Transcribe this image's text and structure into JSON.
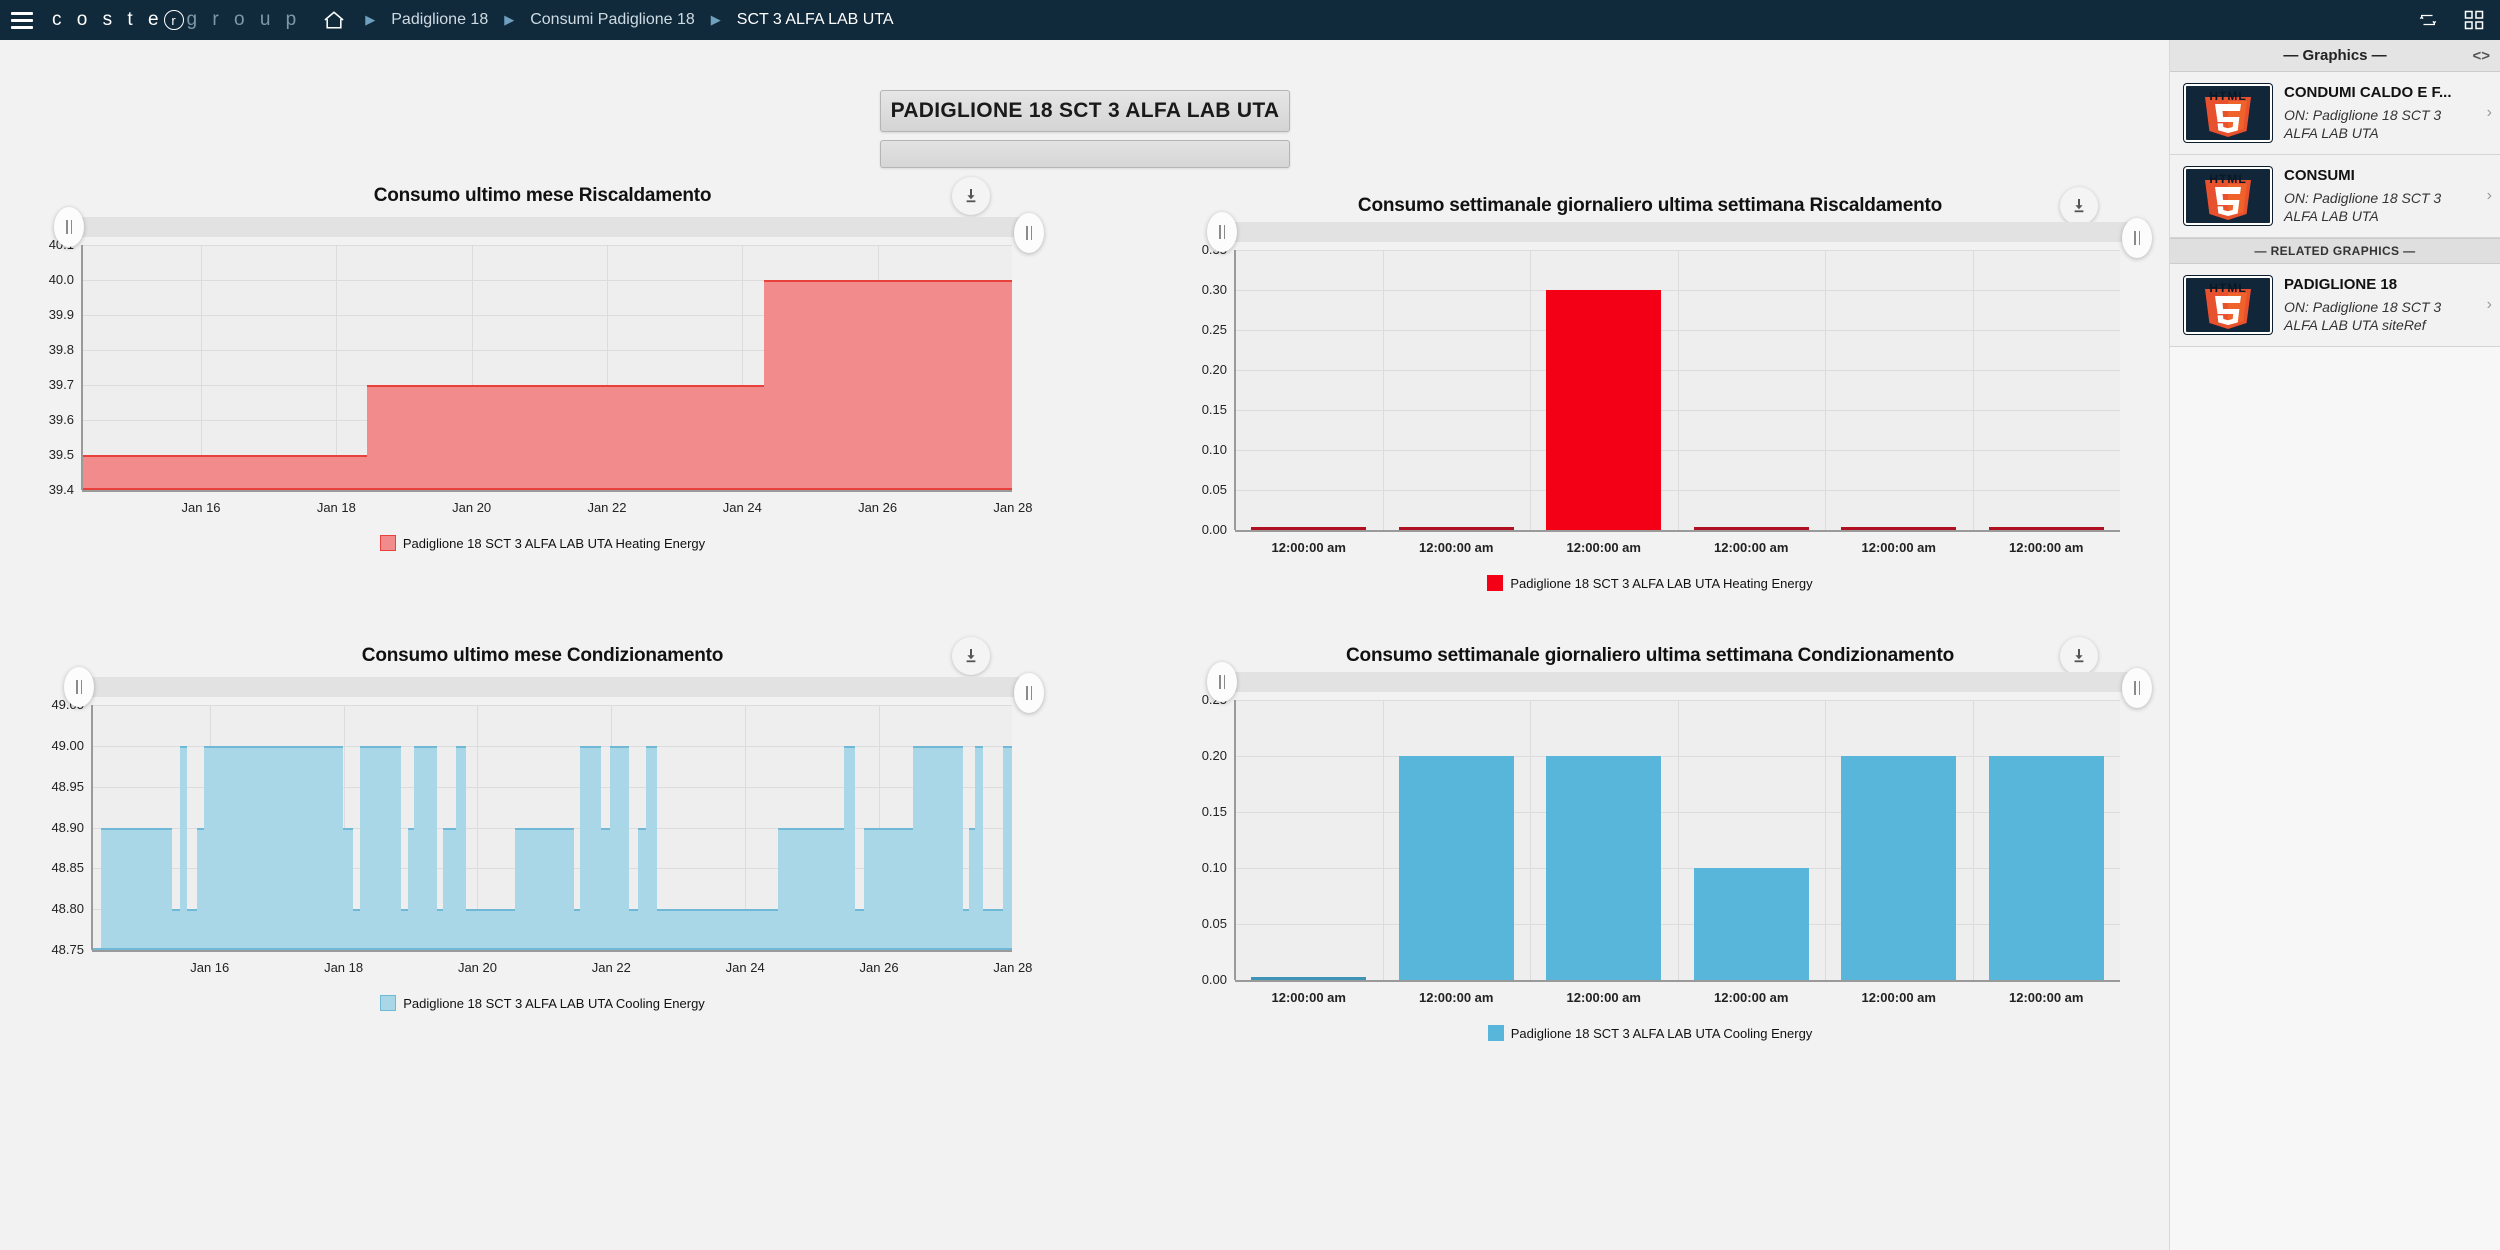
{
  "nav": {
    "menu_icon": "hamburger-icon",
    "brand_part1": "c o s t e",
    "brand_r": "r",
    "brand_part2": "g r o u p",
    "home_icon": "home-icon",
    "breadcrumbs": [
      {
        "label": "Padiglione 18"
      },
      {
        "label": "Consumi Padiglione 18"
      },
      {
        "label": "SCT 3 ALFA LAB UTA"
      }
    ],
    "right_icons": [
      {
        "name": "refresh-cycle-icon"
      },
      {
        "name": "apps-grid-icon"
      }
    ]
  },
  "banner": {
    "title": "PADIGLIONE 18 SCT 3 ALFA LAB UTA",
    "subtitle": ""
  },
  "colors": {
    "nav_bg": "#102a3c",
    "heating_fill": "#f28b8b",
    "heating_stroke": "#e8413c",
    "heating_bar": "#f40016",
    "cooling_fill": "#a9d7e8",
    "cooling_bar": "#57b6da",
    "plot_bg": "#eeeeee"
  },
  "charts": [
    {
      "id": "chart-heating-month",
      "title": "Consumo ultimo mese Riscaldamento",
      "download_icon": "download-icon",
      "legend": "Padiglione 18 SCT 3 ALFA LAB UTA Heating Energy",
      "chart_data": {
        "type": "area",
        "title": "Consumo ultimo mese Riscaldamento",
        "xlabel": "",
        "ylabel": "",
        "ylim": [
          39.4,
          40.1
        ],
        "yticks": [
          "39.4",
          "39.5",
          "39.6",
          "39.7",
          "39.8",
          "39.9",
          "40.0",
          "40.1"
        ],
        "xticks": [
          "Jan 16",
          "Jan 18",
          "Jan 20",
          "Jan 22",
          "Jan 24",
          "Jan 26",
          "Jan 28"
        ],
        "grid": true,
        "legend_position": "bottom",
        "series": [
          {
            "name": "Padiglione 18 SCT 3 ALFA LAB UTA Heating Energy",
            "step_segments": [
              {
                "x_start": 0.0,
                "x_end": 30.6,
                "value": 39.5
              },
              {
                "x_start": 30.6,
                "x_end": 73.3,
                "value": 39.7
              },
              {
                "x_start": 73.3,
                "x_end": 100.0,
                "value": 40.0
              }
            ]
          }
        ]
      }
    },
    {
      "id": "chart-heating-week",
      "title": "Consumo settimanale giornaliero ultima settimana Riscaldamento",
      "download_icon": "download-icon",
      "legend": "Padiglione 18 SCT 3 ALFA LAB UTA Heating Energy",
      "chart_data": {
        "type": "bar",
        "title": "Consumo settimanale giornaliero ultima settimana Riscaldamento",
        "xlabel": "",
        "ylabel": "",
        "ylim": [
          0.0,
          0.35
        ],
        "yticks": [
          "0.00",
          "0.05",
          "0.10",
          "0.15",
          "0.20",
          "0.25",
          "0.30",
          "0.35"
        ],
        "categories": [
          "12:00:00 am",
          "12:00:00 am",
          "12:00:00 am",
          "12:00:00 am",
          "12:00:00 am",
          "12:00:00 am"
        ],
        "values": [
          0.0,
          0.0,
          0.3,
          0.0,
          0.0,
          0.0
        ],
        "grid": true,
        "legend_position": "bottom"
      }
    },
    {
      "id": "chart-cooling-month",
      "title": "Consumo ultimo mese Condizionamento",
      "download_icon": "download-icon",
      "legend": "Padiglione 18 SCT 3 ALFA LAB UTA Cooling Energy",
      "chart_data": {
        "type": "area",
        "title": "Consumo ultimo mese Condizionamento",
        "xlabel": "",
        "ylabel": "",
        "ylim": [
          48.75,
          49.05
        ],
        "yticks": [
          "48.75",
          "48.80",
          "48.85",
          "48.90",
          "48.95",
          "49.00",
          "49.05"
        ],
        "xticks": [
          "Jan 16",
          "Jan 18",
          "Jan 20",
          "Jan 22",
          "Jan 24",
          "Jan 26",
          "Jan 28"
        ],
        "grid": true,
        "legend_position": "bottom",
        "series": [
          {
            "name": "Padiglione 18 SCT 3 ALFA LAB UTA Cooling Energy",
            "step_segments": [
              {
                "x_start": 0.0,
                "x_end": 1.0,
                "value": 48.75
              },
              {
                "x_start": 1.0,
                "x_end": 8.7,
                "value": 48.9
              },
              {
                "x_start": 8.7,
                "x_end": 9.6,
                "value": 48.8
              },
              {
                "x_start": 9.6,
                "x_end": 10.3,
                "value": 49.0
              },
              {
                "x_start": 10.3,
                "x_end": 11.4,
                "value": 48.8
              },
              {
                "x_start": 11.4,
                "x_end": 12.2,
                "value": 48.9
              },
              {
                "x_start": 12.2,
                "x_end": 27.3,
                "value": 49.0
              },
              {
                "x_start": 27.3,
                "x_end": 28.4,
                "value": 48.9
              },
              {
                "x_start": 28.4,
                "x_end": 29.1,
                "value": 48.8
              },
              {
                "x_start": 29.1,
                "x_end": 33.6,
                "value": 49.0
              },
              {
                "x_start": 33.6,
                "x_end": 34.3,
                "value": 48.8
              },
              {
                "x_start": 34.3,
                "x_end": 35.0,
                "value": 48.9
              },
              {
                "x_start": 35.0,
                "x_end": 37.5,
                "value": 49.0
              },
              {
                "x_start": 37.5,
                "x_end": 38.2,
                "value": 48.8
              },
              {
                "x_start": 38.2,
                "x_end": 39.6,
                "value": 48.9
              },
              {
                "x_start": 39.6,
                "x_end": 40.6,
                "value": 49.0
              },
              {
                "x_start": 40.6,
                "x_end": 46.0,
                "value": 48.8
              },
              {
                "x_start": 46.0,
                "x_end": 52.4,
                "value": 48.9
              },
              {
                "x_start": 52.4,
                "x_end": 53.0,
                "value": 48.8
              },
              {
                "x_start": 53.0,
                "x_end": 55.3,
                "value": 49.0
              },
              {
                "x_start": 55.3,
                "x_end": 56.3,
                "value": 48.9
              },
              {
                "x_start": 56.3,
                "x_end": 58.4,
                "value": 49.0
              },
              {
                "x_start": 58.4,
                "x_end": 59.4,
                "value": 48.8
              },
              {
                "x_start": 59.4,
                "x_end": 60.2,
                "value": 48.9
              },
              {
                "x_start": 60.2,
                "x_end": 61.4,
                "value": 49.0
              },
              {
                "x_start": 61.4,
                "x_end": 74.6,
                "value": 48.8
              },
              {
                "x_start": 74.6,
                "x_end": 81.7,
                "value": 48.9
              },
              {
                "x_start": 81.7,
                "x_end": 82.9,
                "value": 49.0
              },
              {
                "x_start": 82.9,
                "x_end": 83.9,
                "value": 48.8
              },
              {
                "x_start": 83.9,
                "x_end": 89.2,
                "value": 48.9
              },
              {
                "x_start": 89.2,
                "x_end": 94.7,
                "value": 49.0
              },
              {
                "x_start": 94.7,
                "x_end": 95.3,
                "value": 48.8
              },
              {
                "x_start": 95.3,
                "x_end": 96.0,
                "value": 48.9
              },
              {
                "x_start": 96.0,
                "x_end": 96.8,
                "value": 49.0
              },
              {
                "x_start": 96.8,
                "x_end": 99.0,
                "value": 48.8
              },
              {
                "x_start": 99.0,
                "x_end": 100.0,
                "value": 49.0
              }
            ]
          }
        ]
      }
    },
    {
      "id": "chart-cooling-week",
      "title": "Consumo settimanale giornaliero ultima settimana Condizionamento",
      "download_icon": "download-icon",
      "legend": "Padiglione 18 SCT 3 ALFA LAB UTA Cooling Energy",
      "chart_data": {
        "type": "bar",
        "title": "Consumo settimanale giornaliero ultima settimana Condizionamento",
        "xlabel": "",
        "ylabel": "",
        "ylim": [
          0.0,
          0.25
        ],
        "yticks": [
          "0.00",
          "0.05",
          "0.10",
          "0.15",
          "0.20",
          "0.25"
        ],
        "categories": [
          "12:00:00 am",
          "12:00:00 am",
          "12:00:00 am",
          "12:00:00 am",
          "12:00:00 am",
          "12:00:00 am"
        ],
        "values": [
          0.0,
          0.2,
          0.2,
          0.1,
          0.2,
          0.2
        ],
        "grid": true,
        "legend_position": "bottom"
      }
    }
  ],
  "sidebar": {
    "header": "— Graphics —",
    "collapse_icon": "collapse-panel-icon",
    "related_header": "— RELATED GRAPHICS —",
    "graphics": [
      {
        "title": "CONDUMI CALDO E F...",
        "desc": "ON: Padiglione 18 SCT 3 ALFA LAB UTA",
        "thumb": "html5-logo",
        "chevron": "chevron-right-icon"
      },
      {
        "title": "CONSUMI",
        "desc": "ON: Padiglione 18 SCT 3 ALFA LAB UTA",
        "thumb": "html5-logo",
        "chevron": "chevron-right-icon"
      }
    ],
    "related": [
      {
        "title": "PADIGLIONE 18",
        "desc": "ON: Padiglione 18 SCT 3 ALFA LAB UTA siteRef",
        "thumb": "html5-logo",
        "chevron": "chevron-right-icon"
      }
    ]
  }
}
